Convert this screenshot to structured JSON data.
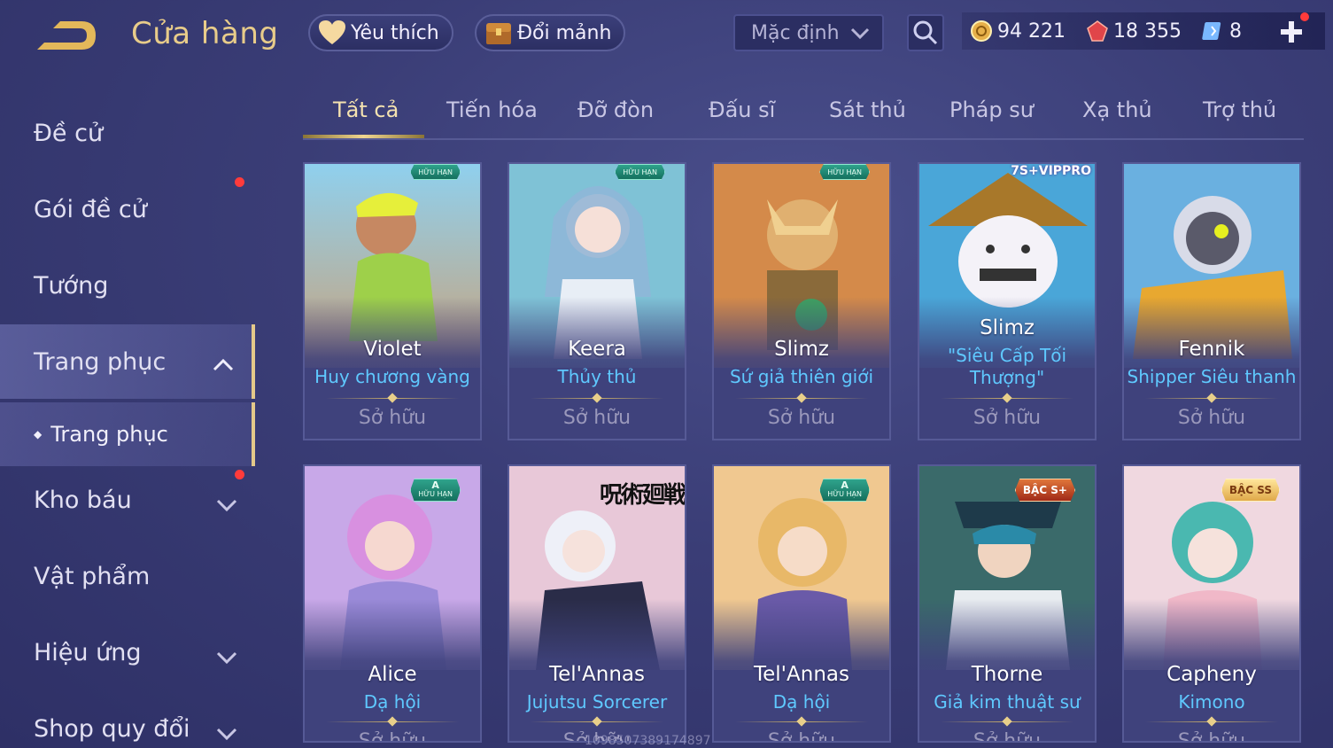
{
  "header": {
    "title": "Cửa hàng",
    "favorites_label": "Yêu thích",
    "exchange_label": "Đổi mảnh",
    "sort_value": "Mặc định",
    "currencies": [
      {
        "icon": "gold-coin-icon",
        "value": "94 221"
      },
      {
        "icon": "red-gem-icon",
        "value": "18 355"
      },
      {
        "icon": "voucher-icon",
        "value": "8"
      }
    ]
  },
  "sidebar": {
    "items": [
      {
        "label": "Đề cử"
      },
      {
        "label": "Gói đề cử"
      },
      {
        "label": "Tướng"
      },
      {
        "label": "Trang phục"
      },
      {
        "label": "Kho báu"
      },
      {
        "label": "Vật phẩm"
      },
      {
        "label": "Hiệu ứng"
      },
      {
        "label": "Shop quy đổi"
      }
    ],
    "subitem": "Trang phục"
  },
  "tabs": [
    "Tất cả",
    "Tiến hóa",
    "Đỡ đòn",
    "Đấu sĩ",
    "Sát thủ",
    "Pháp sư",
    "Xạ thủ",
    "Trợ thủ"
  ],
  "cards": [
    {
      "hero": "Violet",
      "skin": "Huy chương vàng",
      "owned": "Sở hữu",
      "badge": "HỮU HẠN"
    },
    {
      "hero": "Keera",
      "skin": "Thủy thủ",
      "owned": "Sở hữu",
      "badge": "HỮU HẠN"
    },
    {
      "hero": "Slimz",
      "skin": "Sứ giả thiên giới",
      "owned": "Sở hữu",
      "badge": "HỮU HẠN"
    },
    {
      "hero": "Slimz",
      "skin": "\"Siêu Cấp Tối",
      "skin2": "Thượng\"",
      "owned": "Sở hữu",
      "tag": "7S+VIPPRO"
    },
    {
      "hero": "Fennik",
      "skin": "Shipper Siêu thanh",
      "owned": "Sở hữu"
    },
    {
      "hero": "Alice",
      "skin": "Dạ hội",
      "owned": "Sở hữu",
      "grade": "A",
      "badge": "HỮU HẠN"
    },
    {
      "hero": "Tel'Annas",
      "skin": "Jujutsu Sorcerer",
      "owned": "Sở hữu",
      "tag": "呪術廻戦"
    },
    {
      "hero": "Tel'Annas",
      "skin": "Dạ hội",
      "owned": "Sở hữu",
      "grade": "A",
      "badge": "HỮU HẠN"
    },
    {
      "hero": "Thorne",
      "skin": "Giả kim thuật sư",
      "owned": "Sở hữu",
      "badge": "BẬC S+"
    },
    {
      "hero": "Capheny",
      "skin": "Kimono",
      "owned": "Sở hữu",
      "badge": "BẬC SS"
    }
  ],
  "watermark": "1098507389174897",
  "colors": {
    "accent_gold": "#e8cc8a",
    "skin_blue": "#5fc9ff",
    "notify_red": "#ff3b3b"
  }
}
